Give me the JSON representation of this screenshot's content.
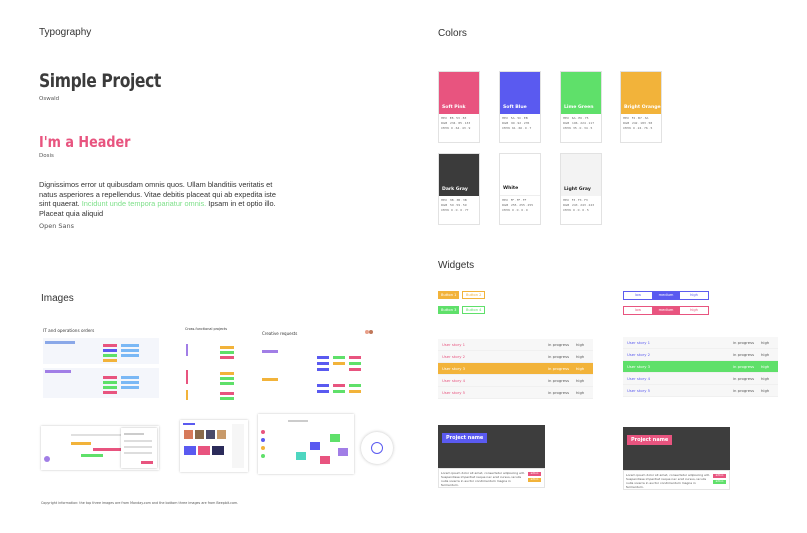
{
  "sections": {
    "typography": "Typography",
    "colors": "Colors",
    "images": "Images",
    "widgets": "Widgets"
  },
  "typography": {
    "sample_title": "Simple Project",
    "title_font": "Oswald",
    "sample_header": "I'm a Header",
    "header_font": "Dosis",
    "body_before": "Dignissimos error ut quibusdam omnis quos. Ullam blanditiis veritatis et natus asperiores a repellendus. Vitae debitis placeat qui ab expedita iste sint quaerat. ",
    "body_highlight": "Incidunt unde tempora pariatur omnis.",
    "body_after": " Ipsam in et optio illo. Placeat quia aliquid",
    "body_font": "Open Sans"
  },
  "colors": [
    {
      "name": "Soft Pink",
      "hex": "#e8547f",
      "hex_label": "HEX",
      "hex_val": "E8 · 53 · 83",
      "rgb_label": "RGB",
      "rgb_val": "234 · 85 · 133",
      "cmyk_label": "CMYK",
      "cmyk_val": "0 · 64 · 43 · 9"
    },
    {
      "name": "Soft Blue",
      "hex": "#5a5af0",
      "hex_label": "HEX",
      "hex_val": "5A · 5C · EB",
      "rgb_label": "RGB",
      "rgb_val": "90 · 92 · 235",
      "cmyk_label": "CMYK",
      "cmyk_val": "61 · 60 · 0 · 7"
    },
    {
      "name": "Lime Green",
      "hex": "#5fe06a",
      "hex_label": "HEX",
      "hex_val": "6A · E0 · 75",
      "rgb_label": "RGB",
      "rgb_val": "106 · 224 · 117",
      "cmyk_label": "CMYK",
      "cmyk_val": "35 · 0 · 34 · 5"
    },
    {
      "name": "Bright Orange",
      "hex": "#f2b33a",
      "hex_label": "HEX",
      "hex_val": "F2 · B7 · 3A",
      "rgb_label": "RGB",
      "rgb_val": "242 · 183 · 58",
      "cmyk_label": "CMYK",
      "cmyk_val": "0 · 24 · 76 · 5"
    },
    {
      "name": "Dark Gray",
      "hex": "#3b3b3b",
      "hex_label": "HEX",
      "hex_val": "3B · 3B · 3B",
      "rgb_label": "RGB",
      "rgb_val": "59 · 59 · 59",
      "cmyk_label": "CMYK",
      "cmyk_val": "0 · 0 · 0 · 77"
    },
    {
      "name": "White",
      "hex": "#ffffff",
      "hex_label": "HEX",
      "hex_val": "FF · FF · FF",
      "rgb_label": "RGB",
      "rgb_val": "255 · 255 · 255",
      "cmyk_label": "CMYK",
      "cmyk_val": "0 · 0 · 0 · 0"
    },
    {
      "name": "Light Gray",
      "hex": "#f3f3f3",
      "hex_label": "HEX",
      "hex_val": "F3 · F3 · F3",
      "rgb_label": "RGB",
      "rgb_val": "243 · 243 · 243",
      "cmyk_label": "CMYK",
      "cmyk_val": "0 · 0 · 0 · 5"
    }
  ],
  "images": {
    "thumb1_title": "IT and operations orders",
    "thumb2_title": "Cross-functional projects",
    "thumb3_title": "Creative requests",
    "copyright": "Copyright information: the top three images are from Monday.com and the bottom three images are from Beepbit.com."
  },
  "widgets": {
    "buttons": {
      "btn1": "Button 1",
      "btn2": "Button 2",
      "btn3": "Button 3",
      "btn4": "Button 4"
    },
    "segments": {
      "low": "low",
      "medium": "medium",
      "high": "high"
    },
    "table_pink": [
      {
        "story": "User story 1",
        "status": "in progress",
        "priority": "high"
      },
      {
        "story": "User story 2",
        "status": "in progress",
        "priority": "high"
      },
      {
        "story": "User story 3",
        "status": "in progress",
        "priority": "high"
      },
      {
        "story": "User story 4",
        "status": "in progress",
        "priority": "high"
      },
      {
        "story": "User story 5",
        "status": "in progress",
        "priority": "high"
      }
    ],
    "table_blue": [
      {
        "story": "User story 1",
        "status": "in progress",
        "priority": "high"
      },
      {
        "story": "User story 2",
        "status": "in progress",
        "priority": "high"
      },
      {
        "story": "User story 3",
        "status": "in progress",
        "priority": "high"
      },
      {
        "story": "User story 4",
        "status": "in progress",
        "priority": "high"
      },
      {
        "story": "User story 5",
        "status": "in progress",
        "priority": "high"
      }
    ],
    "card_blue": {
      "title": "Project name",
      "body": "Lorem ipsum dolor sit amet, consectetur adipiscing elit. Suspendisse imperdiet neque nec erat cursus, iaculis nulla viverra in auctor condimentum magna in fermentum.",
      "btn1": "action",
      "btn2": "action"
    },
    "card_pink": {
      "title": "Project name",
      "body": "Lorem ipsum dolor sit amet, consectetur adipiscing elit. Suspendisse imperdiet neque nec erat cursus, iaculis nulla viverra in auctor condimentum magna in fermentum.",
      "btn1": "action",
      "btn2": "action"
    }
  }
}
